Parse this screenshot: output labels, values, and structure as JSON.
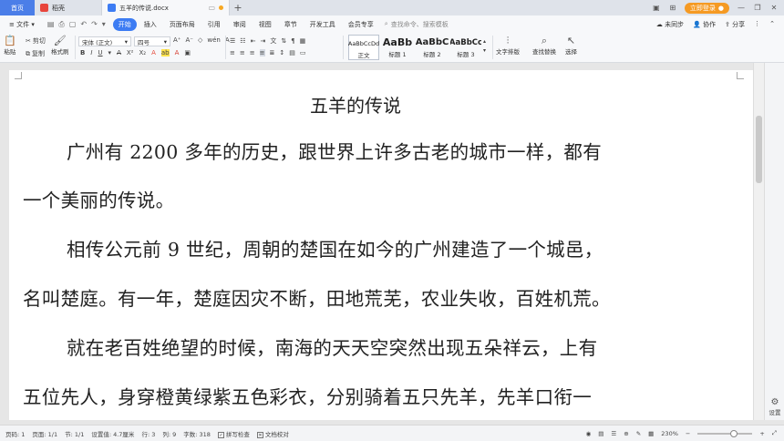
{
  "tabs": {
    "home": "首页",
    "daoke": "稻壳",
    "doc": "五羊的传说.docx",
    "login": "立即登录"
  },
  "menu": {
    "file": "文件",
    "items": [
      "开始",
      "插入",
      "页面布局",
      "引用",
      "审阅",
      "视图",
      "章节",
      "开发工具",
      "会员专享"
    ],
    "search": "查找命令、搜索模板",
    "sync": "未同步",
    "collab": "协作",
    "share": "分享"
  },
  "ribbon": {
    "paste": "粘贴",
    "cut": "剪切",
    "copy": "复制",
    "format_painter": "格式刷",
    "font_family": "宋体 (正文)",
    "font_size": "四号",
    "styles": [
      {
        "sample": "AaBbCcDd",
        "label": "正文"
      },
      {
        "sample": "AaBb",
        "label": "标题 1"
      },
      {
        "sample": "AaBbC",
        "label": "标题 2"
      },
      {
        "sample": "AaBbCc",
        "label": "标题 3"
      }
    ],
    "text_layout": "文字排版",
    "find_replace": "查找替换",
    "select": "选择"
  },
  "document": {
    "title": "五羊的传说",
    "lines": [
      "广州有 2200 多年的历史，跟世界上许多古老的城市一样，都有",
      "一个美丽的传说。",
      "相传公元前 9 世纪，周朝的楚国在如今的广州建造了一个城邑，",
      "名叫楚庭。有一年，楚庭因灾不断，田地荒芜，农业失收，百姓机荒。",
      "就在老百姓绝望的时候，南海的天天空突然出现五朵祥云，上有",
      "五位先人，身穿橙黄绿紫五色彩衣，分别骑着五只先羊，先羊口衔一"
    ]
  },
  "side": {
    "settings": "设置"
  },
  "status": {
    "page": "页码: 1",
    "pages": "页面: 1/1",
    "section": "节: 1/1",
    "position": "设置值: 4.7厘米",
    "row": "行: 3",
    "col": "列: 9",
    "words": "字数: 318",
    "spellcheck": "拼写检查",
    "proof": "文档校对",
    "zoom": "230%"
  },
  "colors": {
    "accent": "#3d7cf3",
    "home_tab": "#4b7ee8",
    "login": "#f59a23"
  }
}
